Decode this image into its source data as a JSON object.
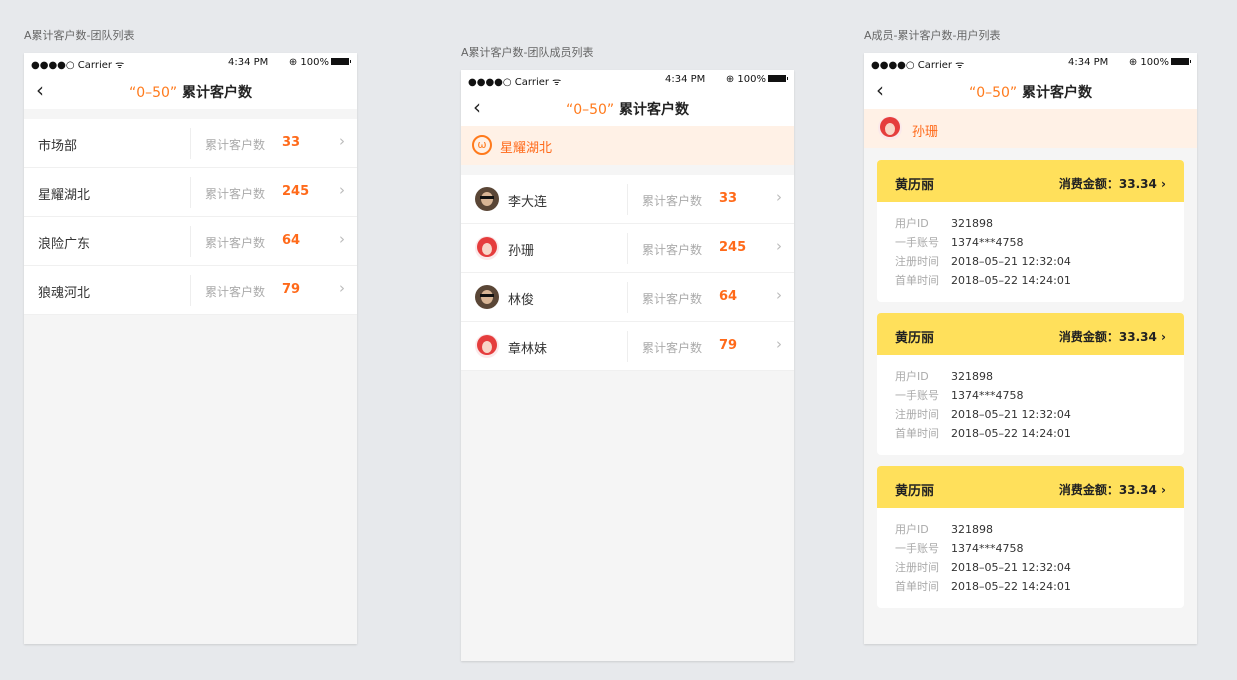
{
  "statusbar": {
    "signal": "●●●●○ Carrier ᯤ",
    "time": "4:34 PM",
    "battery": "⊕ 100%"
  },
  "boards": [
    {
      "label": "A累计客户数-团队列表"
    },
    {
      "label": "A累计客户数-团队成员列表"
    },
    {
      "label": "A成员-累计客户数-用户列表"
    }
  ],
  "nav": {
    "back": "‹",
    "range": "“0–50”",
    "title": "累计客户数"
  },
  "metric_label": "累计客户数",
  "chevron": "›",
  "teams": [
    {
      "name": "市场部",
      "value": "33"
    },
    {
      "name": "星耀湖北",
      "value": "245"
    },
    {
      "name": "浪险广东",
      "value": "64"
    },
    {
      "name": "狼魂河北",
      "value": "79"
    }
  ],
  "team_header": {
    "name": "星耀湖北",
    "icon": "team-icon"
  },
  "members": [
    {
      "name": "李大连",
      "value": "33",
      "avatar": "man"
    },
    {
      "name": "孙珊",
      "value": "245",
      "avatar": "woman"
    },
    {
      "name": "林俊",
      "value": "64",
      "avatar": "man"
    },
    {
      "name": "章林妹",
      "value": "79",
      "avatar": "woman"
    }
  ],
  "user_header": {
    "name": "孙珊"
  },
  "cards": [
    {
      "name": "黄历丽",
      "amount": "消费金额：33.34 ›",
      "lines": [
        [
          "用户ID",
          "321898"
        ],
        [
          "一手账号",
          "1374***4758"
        ],
        [
          "注册时间",
          "2018–05–21 12:32:04"
        ],
        [
          "首单时间",
          "2018–05–22 14:24:01"
        ]
      ]
    },
    {
      "name": "黄历丽",
      "amount": "消费金额：33.34 ›",
      "lines": [
        [
          "用户ID",
          "321898"
        ],
        [
          "一手账号",
          "1374***4758"
        ],
        [
          "注册时间",
          "2018–05–21 12:32:04"
        ],
        [
          "首单时间",
          "2018–05–22 14:24:01"
        ]
      ]
    },
    {
      "name": "黄历丽",
      "amount": "消费金额：33.34 ›",
      "lines": [
        [
          "用户ID",
          "321898"
        ],
        [
          "一手账号",
          "1374***4758"
        ],
        [
          "注册时间",
          "2018–05–21 12:32:04"
        ],
        [
          "首单时间",
          "2018–05–22 14:24:01"
        ]
      ]
    }
  ],
  "colors": {
    "accent": "#ff6a1a",
    "card_header": "#ffe05b",
    "team_bg": "#fff1e6"
  }
}
